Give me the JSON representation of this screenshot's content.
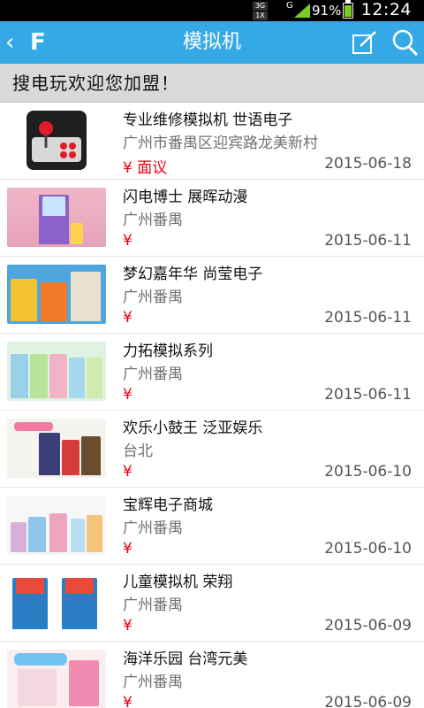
{
  "status_bar": {
    "network_top": "3G",
    "network_bottom": "1X",
    "signal_type": "G",
    "battery_percent": "91%",
    "time": "12:24",
    "battery_color": "#7ccc1f"
  },
  "app_bar": {
    "title": "模拟机",
    "background": "#35a9e6",
    "back_icon": "chevron-left-icon",
    "logo_text": "F",
    "edit_icon": "edit-icon",
    "search_icon": "search-icon"
  },
  "banner": {
    "text": "搜电玩欢迎您加盟！"
  },
  "items": [
    {
      "title": "专业维修模拟机 世语电子",
      "location": "广州市番禺区迎宾路龙美新村",
      "price": "¥ 面议",
      "date": "2015-06-18"
    },
    {
      "title": "闪电博士 展晖动漫",
      "location": "广州番禺",
      "price": "¥",
      "date": "2015-06-11"
    },
    {
      "title": "梦幻嘉年华 尚莹电子",
      "location": "广州番禺",
      "price": "¥",
      "date": "2015-06-11"
    },
    {
      "title": "力拓模拟系列",
      "location": "广州番禺",
      "price": "¥",
      "date": "2015-06-11"
    },
    {
      "title": "欢乐小鼓王 泛亚娱乐",
      "location": "台北",
      "price": "¥",
      "date": "2015-06-10"
    },
    {
      "title": "宝辉电子商城",
      "location": "广州番禺",
      "price": "¥",
      "date": "2015-06-10"
    },
    {
      "title": "儿童模拟机 荣翔",
      "location": "广州番禺",
      "price": "¥",
      "date": "2015-06-09"
    },
    {
      "title": "海洋乐园 台湾元美",
      "location": "广州番禺",
      "price": "¥",
      "date": "2015-06-09"
    }
  ]
}
